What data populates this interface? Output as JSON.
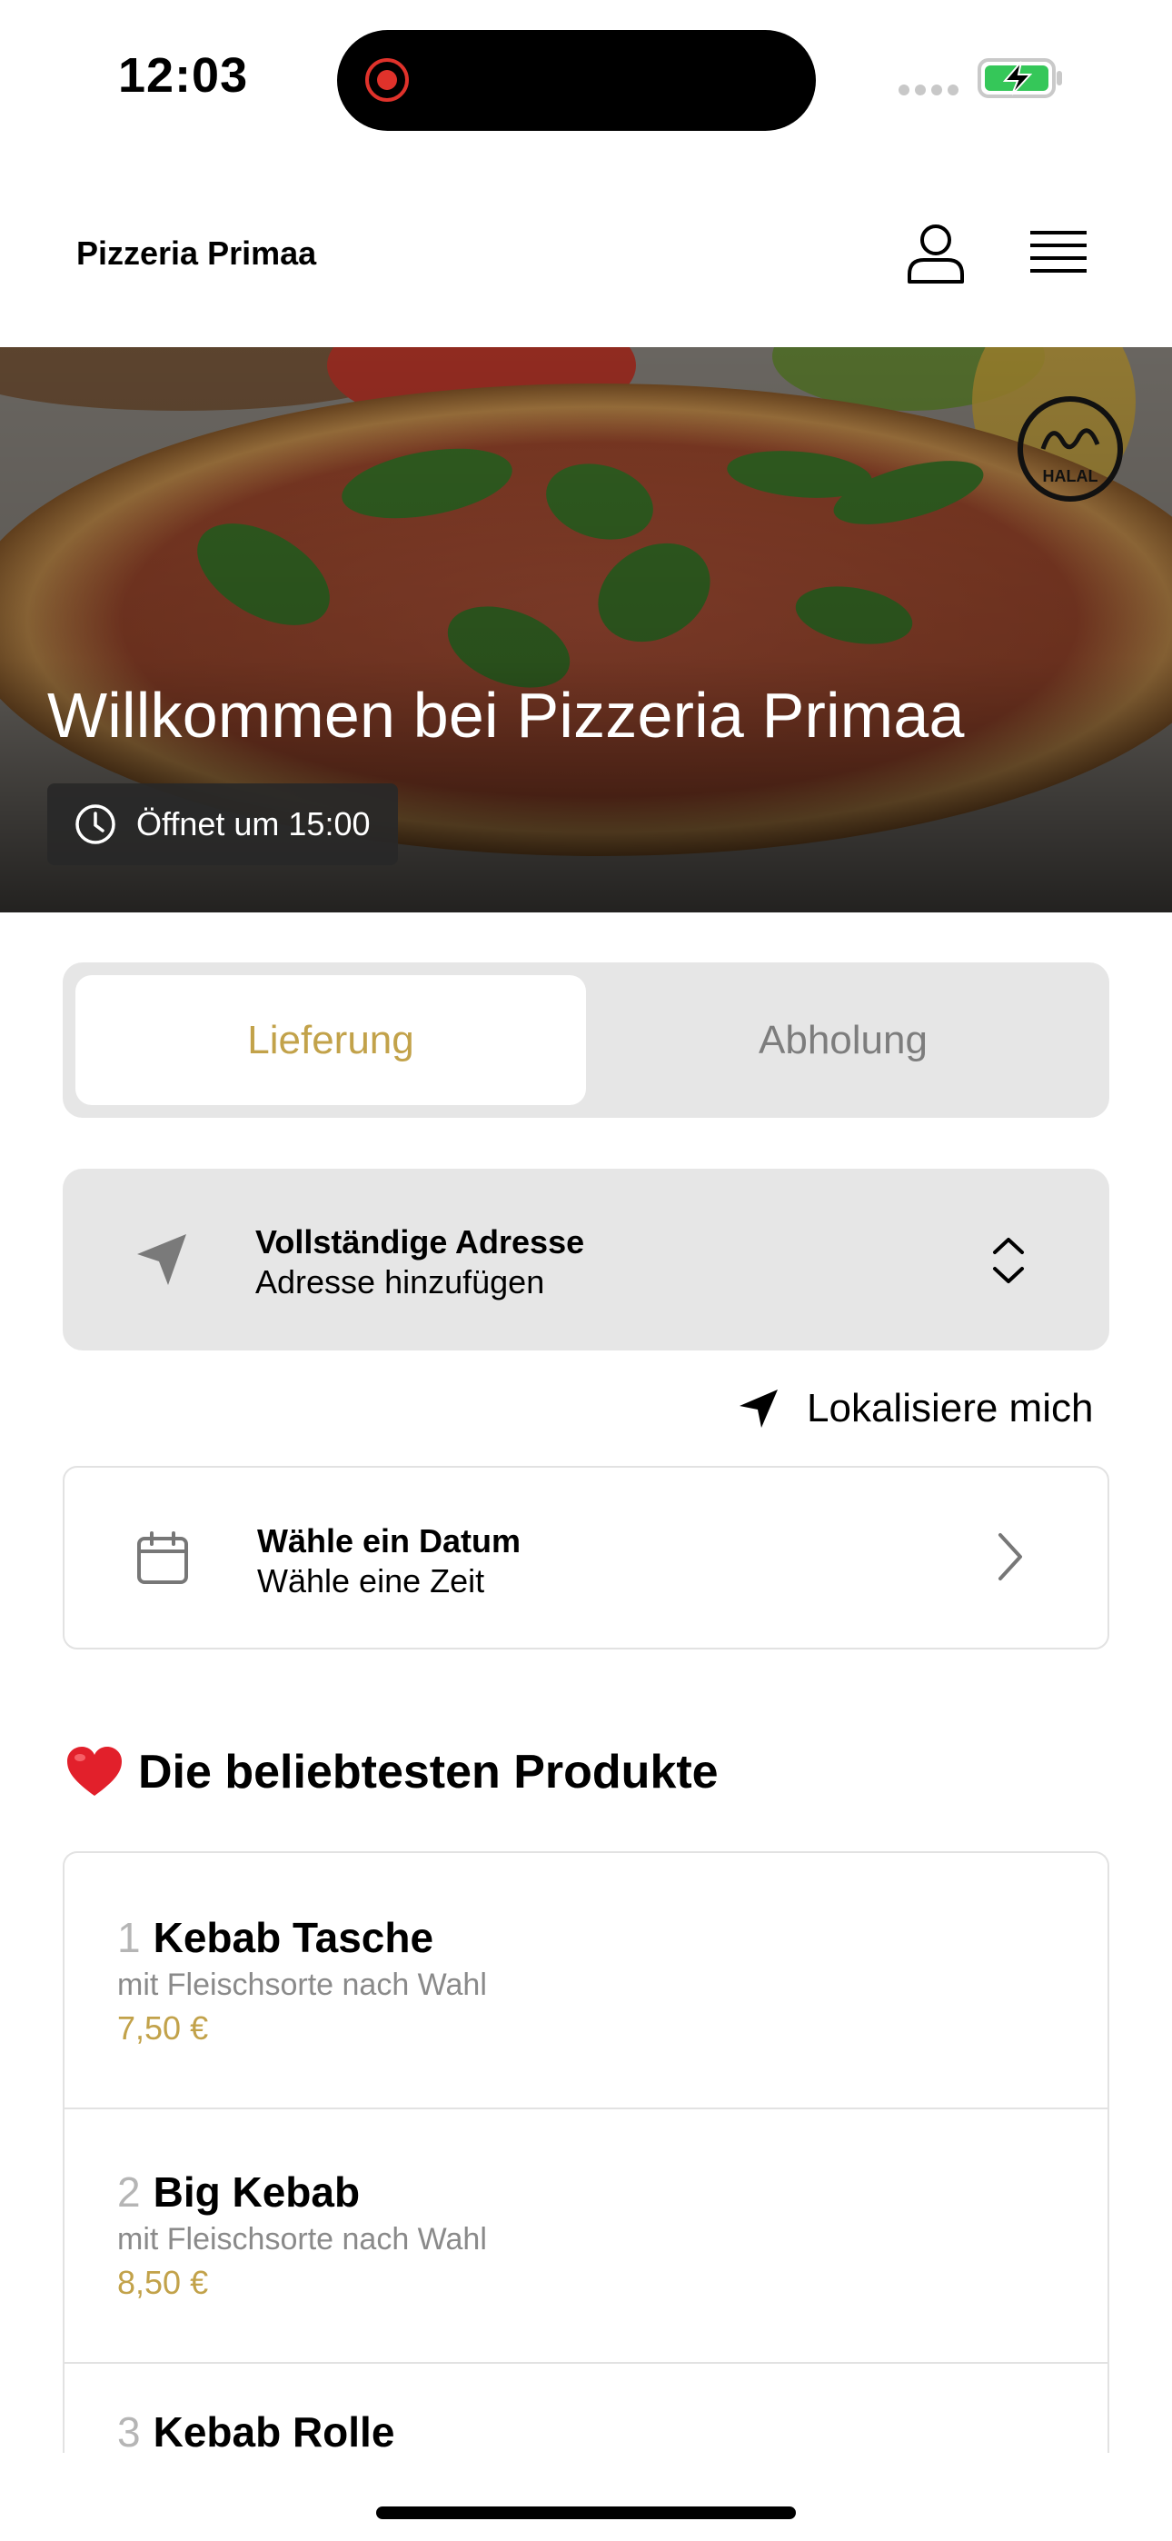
{
  "status_bar": {
    "time": "12:03"
  },
  "header": {
    "brand": "Pizzeria Primaa"
  },
  "hero": {
    "title": "Willkommen bei Pizzeria Primaa",
    "hours": "Öffnet um 15:00",
    "badge": "HALAL"
  },
  "tabs": [
    {
      "label": "Lieferung",
      "active": true
    },
    {
      "label": "Abholung",
      "active": false
    }
  ],
  "address": {
    "title": "Vollständige Adresse",
    "subtitle": "Adresse hinzufügen"
  },
  "locate_label": "Lokalisiere mich",
  "schedule": {
    "title": "Wähle ein Datum",
    "subtitle": "Wähle eine Zeit"
  },
  "popular": {
    "title": "Die beliebtesten Produkte",
    "items": [
      {
        "rank": "1",
        "name": "Kebab Tasche",
        "description": "mit Fleischsorte nach Wahl",
        "price": "7,50 €"
      },
      {
        "rank": "2",
        "name": "Big Kebab",
        "description": "mit Fleischsorte nach Wahl",
        "price": "8,50 €"
      },
      {
        "rank": "3",
        "name": "Kebab Rolle",
        "description": "",
        "price": ""
      }
    ]
  },
  "colors": {
    "accent": "#c2a24a",
    "panel": "#e6e6e6",
    "muted": "#8a8a8a"
  }
}
